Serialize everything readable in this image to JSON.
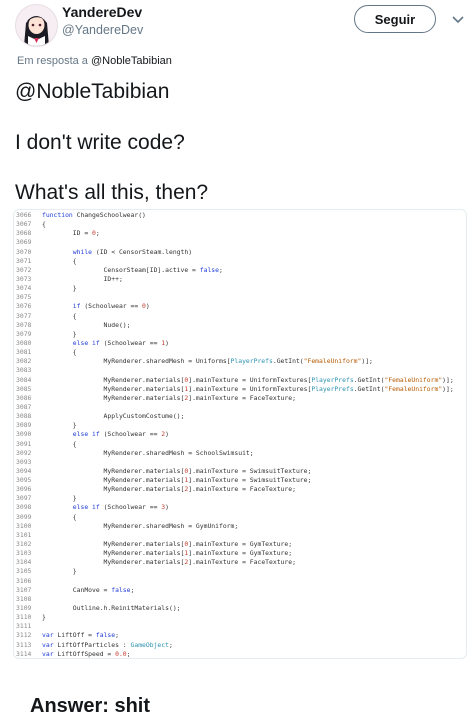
{
  "author": {
    "display_name": "YandereDev",
    "handle": "@YandereDev"
  },
  "follow_button": {
    "label": "Seguir"
  },
  "reply_context": {
    "prefix": "Em resposta a ",
    "mention": "@NobleTabibian"
  },
  "tweet": {
    "lines": [
      "@NobleTabibian",
      "I don't write code?",
      "What's all this, then?"
    ]
  },
  "answer": "Answer: shit",
  "code": {
    "lines": [
      {
        "n": "3066",
        "t": [
          {
            "k": "kw",
            "v": "function "
          },
          {
            "v": "ChangeSchoolwear()"
          }
        ]
      },
      {
        "n": "3067",
        "t": [
          {
            "v": "{"
          }
        ]
      },
      {
        "n": "3068",
        "t": [
          {
            "v": "        ID = "
          },
          {
            "k": "num",
            "v": "0"
          },
          {
            "v": ";"
          }
        ]
      },
      {
        "n": "3069",
        "t": []
      },
      {
        "n": "3070",
        "t": [
          {
            "v": "        "
          },
          {
            "k": "kw",
            "v": "while"
          },
          {
            "v": " (ID < CensorSteam.length)"
          }
        ]
      },
      {
        "n": "3071",
        "t": [
          {
            "v": "        {"
          }
        ]
      },
      {
        "n": "3072",
        "t": [
          {
            "v": "                CensorSteam[ID].active = "
          },
          {
            "k": "kw",
            "v": "false"
          },
          {
            "v": ";"
          }
        ]
      },
      {
        "n": "3073",
        "t": [
          {
            "v": "                ID++;"
          }
        ]
      },
      {
        "n": "3074",
        "t": [
          {
            "v": "        }"
          }
        ]
      },
      {
        "n": "3075",
        "t": []
      },
      {
        "n": "3076",
        "t": [
          {
            "v": "        "
          },
          {
            "k": "kw",
            "v": "if"
          },
          {
            "v": " (Schoolwear == "
          },
          {
            "k": "num",
            "v": "0"
          },
          {
            "v": ")"
          }
        ]
      },
      {
        "n": "3077",
        "t": [
          {
            "v": "        {"
          }
        ]
      },
      {
        "n": "3078",
        "t": [
          {
            "v": "                Nude();"
          }
        ]
      },
      {
        "n": "3079",
        "t": [
          {
            "v": "        }"
          }
        ]
      },
      {
        "n": "3080",
        "t": [
          {
            "v": "        "
          },
          {
            "k": "kw",
            "v": "else if"
          },
          {
            "v": " (Schoolwear == "
          },
          {
            "k": "num",
            "v": "1"
          },
          {
            "v": ")"
          }
        ]
      },
      {
        "n": "3081",
        "t": [
          {
            "v": "        {"
          }
        ]
      },
      {
        "n": "3082",
        "t": [
          {
            "v": "                MyRenderer.sharedMesh = Uniforms["
          },
          {
            "k": "cls",
            "v": "PlayerPrefs"
          },
          {
            "v": ".GetInt("
          },
          {
            "k": "str",
            "v": "\"FemaleUniform\""
          },
          {
            "v": ")];"
          }
        ]
      },
      {
        "n": "3083",
        "t": []
      },
      {
        "n": "3084",
        "t": [
          {
            "v": "                MyRenderer.materials["
          },
          {
            "k": "num",
            "v": "0"
          },
          {
            "v": "].mainTexture = UniformTextures["
          },
          {
            "k": "cls",
            "v": "PlayerPrefs"
          },
          {
            "v": ".GetInt("
          },
          {
            "k": "str",
            "v": "\"FemaleUniform\""
          },
          {
            "v": ")];"
          }
        ]
      },
      {
        "n": "3085",
        "t": [
          {
            "v": "                MyRenderer.materials["
          },
          {
            "k": "num",
            "v": "1"
          },
          {
            "v": "].mainTexture = UniformTextures["
          },
          {
            "k": "cls",
            "v": "PlayerPrefs"
          },
          {
            "v": ".GetInt("
          },
          {
            "k": "str",
            "v": "\"FemaleUniform\""
          },
          {
            "v": ")];"
          }
        ]
      },
      {
        "n": "3086",
        "t": [
          {
            "v": "                MyRenderer.materials["
          },
          {
            "k": "num",
            "v": "2"
          },
          {
            "v": "].mainTexture = FaceTexture;"
          }
        ]
      },
      {
        "n": "3087",
        "t": []
      },
      {
        "n": "3088",
        "t": [
          {
            "v": "                ApplyCustomCostume();"
          }
        ]
      },
      {
        "n": "3089",
        "t": [
          {
            "v": "        }"
          }
        ]
      },
      {
        "n": "3090",
        "t": [
          {
            "v": "        "
          },
          {
            "k": "kw",
            "v": "else if"
          },
          {
            "v": " (Schoolwear == "
          },
          {
            "k": "num",
            "v": "2"
          },
          {
            "v": ")"
          }
        ]
      },
      {
        "n": "3091",
        "t": [
          {
            "v": "        {"
          }
        ]
      },
      {
        "n": "3092",
        "t": [
          {
            "v": "                MyRenderer.sharedMesh = SchoolSwimsuit;"
          }
        ]
      },
      {
        "n": "3093",
        "t": []
      },
      {
        "n": "3094",
        "t": [
          {
            "v": "                MyRenderer.materials["
          },
          {
            "k": "num",
            "v": "0"
          },
          {
            "v": "].mainTexture = SwimsuitTexture;"
          }
        ]
      },
      {
        "n": "3095",
        "t": [
          {
            "v": "                MyRenderer.materials["
          },
          {
            "k": "num",
            "v": "1"
          },
          {
            "v": "].mainTexture = SwimsuitTexture;"
          }
        ]
      },
      {
        "n": "3096",
        "t": [
          {
            "v": "                MyRenderer.materials["
          },
          {
            "k": "num",
            "v": "2"
          },
          {
            "v": "].mainTexture = FaceTexture;"
          }
        ]
      },
      {
        "n": "3097",
        "t": [
          {
            "v": "        }"
          }
        ]
      },
      {
        "n": "3098",
        "t": [
          {
            "v": "        "
          },
          {
            "k": "kw",
            "v": "else if"
          },
          {
            "v": " (Schoolwear == "
          },
          {
            "k": "num",
            "v": "3"
          },
          {
            "v": ")"
          }
        ]
      },
      {
        "n": "3099",
        "t": [
          {
            "v": "        {"
          }
        ]
      },
      {
        "n": "3100",
        "t": [
          {
            "v": "                MyRenderer.sharedMesh = GymUniform;"
          }
        ]
      },
      {
        "n": "3101",
        "t": []
      },
      {
        "n": "3102",
        "t": [
          {
            "v": "                MyRenderer.materials["
          },
          {
            "k": "num",
            "v": "0"
          },
          {
            "v": "].mainTexture = GymTexture;"
          }
        ]
      },
      {
        "n": "3103",
        "t": [
          {
            "v": "                MyRenderer.materials["
          },
          {
            "k": "num",
            "v": "1"
          },
          {
            "v": "].mainTexture = GymTexture;"
          }
        ]
      },
      {
        "n": "3104",
        "t": [
          {
            "v": "                MyRenderer.materials["
          },
          {
            "k": "num",
            "v": "2"
          },
          {
            "v": "].mainTexture = FaceTexture;"
          }
        ]
      },
      {
        "n": "3105",
        "t": [
          {
            "v": "        }"
          }
        ]
      },
      {
        "n": "3106",
        "t": []
      },
      {
        "n": "3107",
        "t": [
          {
            "v": "        CanMove = "
          },
          {
            "k": "kw",
            "v": "false"
          },
          {
            "v": ";"
          }
        ]
      },
      {
        "n": "3108",
        "t": []
      },
      {
        "n": "3109",
        "t": [
          {
            "v": "        Outline.h.ReinitMaterials();"
          }
        ]
      },
      {
        "n": "3110",
        "t": [
          {
            "v": "}"
          }
        ]
      },
      {
        "n": "3111",
        "t": []
      },
      {
        "n": "3112",
        "t": [
          {
            "k": "kw",
            "v": "var"
          },
          {
            "v": " LiftOff = "
          },
          {
            "k": "kw",
            "v": "false"
          },
          {
            "v": ";"
          }
        ]
      },
      {
        "n": "3113",
        "t": [
          {
            "k": "kw",
            "v": "var"
          },
          {
            "v": " LiftOffParticles : "
          },
          {
            "k": "cls",
            "v": "GameObject"
          },
          {
            "v": ";"
          }
        ]
      },
      {
        "n": "3114",
        "t": [
          {
            "k": "kw",
            "v": "var"
          },
          {
            "v": " LiftOffSpeed = "
          },
          {
            "k": "num",
            "v": "0.0"
          },
          {
            "v": ";"
          }
        ]
      }
    ]
  }
}
